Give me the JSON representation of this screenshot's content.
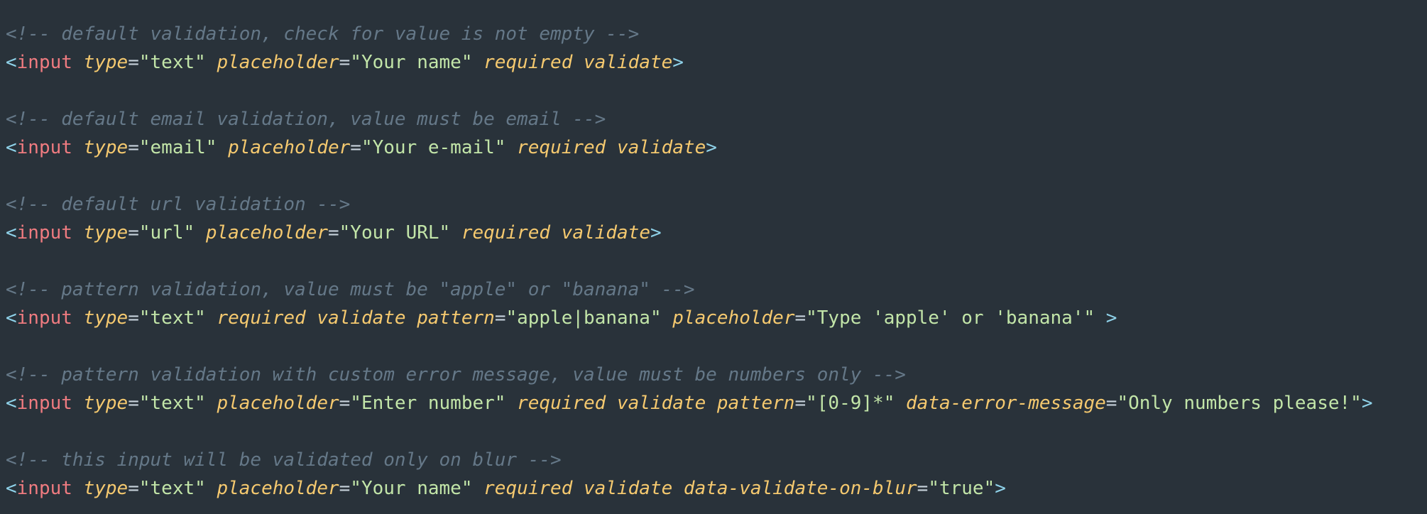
{
  "colors": {
    "background": "#29323a",
    "comment": "#657888",
    "tag": "#ef7b80",
    "attribute": "#f5c96f",
    "string": "#c2e5a8",
    "punctuation": "#8fd2e9"
  },
  "lines": [
    {
      "comment": "<!-- default validation, check for value is not empty -->",
      "tag": "input",
      "parts": [
        {
          "attr": "type",
          "value": "\"text\""
        },
        {
          "attr": "placeholder",
          "value": "\"Your name\""
        },
        {
          "attr": "required"
        },
        {
          "attr": "validate"
        }
      ],
      "close": ">"
    },
    {
      "comment": "<!-- default email validation, value must be email -->",
      "tag": "input",
      "parts": [
        {
          "attr": "type",
          "value": "\"email\""
        },
        {
          "attr": "placeholder",
          "value": "\"Your e-mail\""
        },
        {
          "attr": "required"
        },
        {
          "attr": "validate"
        }
      ],
      "close": ">"
    },
    {
      "comment": "<!-- default url validation -->",
      "tag": "input",
      "parts": [
        {
          "attr": "type",
          "value": "\"url\""
        },
        {
          "attr": "placeholder",
          "value": "\"Your URL\""
        },
        {
          "attr": "required"
        },
        {
          "attr": "validate"
        }
      ],
      "close": ">"
    },
    {
      "comment": "<!-- pattern validation, value must be \"apple\" or \"banana\" -->",
      "tag": "input",
      "parts": [
        {
          "attr": "type",
          "value": "\"text\""
        },
        {
          "attr": "required"
        },
        {
          "attr": "validate"
        },
        {
          "attr": "pattern",
          "value": "\"apple|banana\""
        },
        {
          "attr": "placeholder",
          "value": "\"Type 'apple' or 'banana'\""
        }
      ],
      "close": " >"
    },
    {
      "comment": "<!-- pattern validation with custom error message, value must be numbers only -->",
      "tag": "input",
      "parts": [
        {
          "attr": "type",
          "value": "\"text\""
        },
        {
          "attr": "placeholder",
          "value": "\"Enter number\""
        },
        {
          "attr": "required"
        },
        {
          "attr": "validate"
        },
        {
          "attr": "pattern",
          "value": "\"[0-9]*\""
        },
        {
          "attr": "data-error-message",
          "value": "\"Only numbers please!\""
        }
      ],
      "close": ">"
    },
    {
      "comment": "<!-- this input will be validated only on blur -->",
      "tag": "input",
      "parts": [
        {
          "attr": "type",
          "value": "\"text\""
        },
        {
          "attr": "placeholder",
          "value": "\"Your name\""
        },
        {
          "attr": "required"
        },
        {
          "attr": "validate"
        },
        {
          "attr": "data-validate-on-blur",
          "value": "\"true\""
        }
      ],
      "close": ">"
    }
  ]
}
